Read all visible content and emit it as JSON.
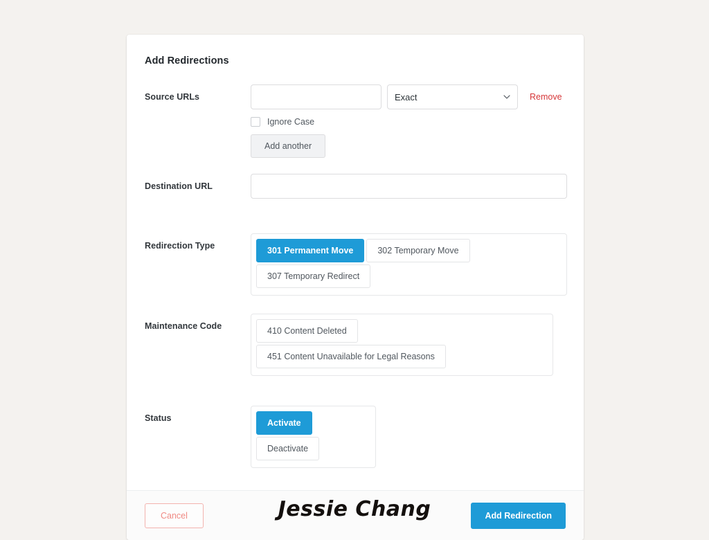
{
  "page": {
    "background_color": "#f4f2ef",
    "signature": "Jessie Chang"
  },
  "card": {
    "title": "Add Redirections",
    "accent_color": "#1e9bd7",
    "danger_color": "#d63638",
    "cancel_color": "#f08a84"
  },
  "fields": {
    "source": {
      "label": "Source URLs",
      "url_value": "",
      "url_placeholder": "",
      "match_type_selected": "Exact",
      "match_type_options": [
        "Exact"
      ],
      "remove_label": "Remove",
      "ignore_case_label": "Ignore Case",
      "ignore_case_checked": false,
      "add_another_label": "Add another"
    },
    "destination": {
      "label": "Destination URL",
      "value": "",
      "placeholder": ""
    },
    "redirection_type": {
      "label": "Redirection Type",
      "options": [
        {
          "label": "301 Permanent Move",
          "active": true
        },
        {
          "label": "302 Temporary Move",
          "active": false
        },
        {
          "label": "307 Temporary Redirect",
          "active": false
        }
      ]
    },
    "maintenance_code": {
      "label": "Maintenance Code",
      "options": [
        {
          "label": "410 Content Deleted",
          "active": false
        },
        {
          "label": "451 Content Unavailable for Legal Reasons",
          "active": false
        }
      ]
    },
    "status": {
      "label": "Status",
      "options": [
        {
          "label": "Activate",
          "active": true
        },
        {
          "label": "Deactivate",
          "active": false
        }
      ]
    }
  },
  "footer": {
    "cancel_label": "Cancel",
    "submit_label": "Add Redirection"
  }
}
